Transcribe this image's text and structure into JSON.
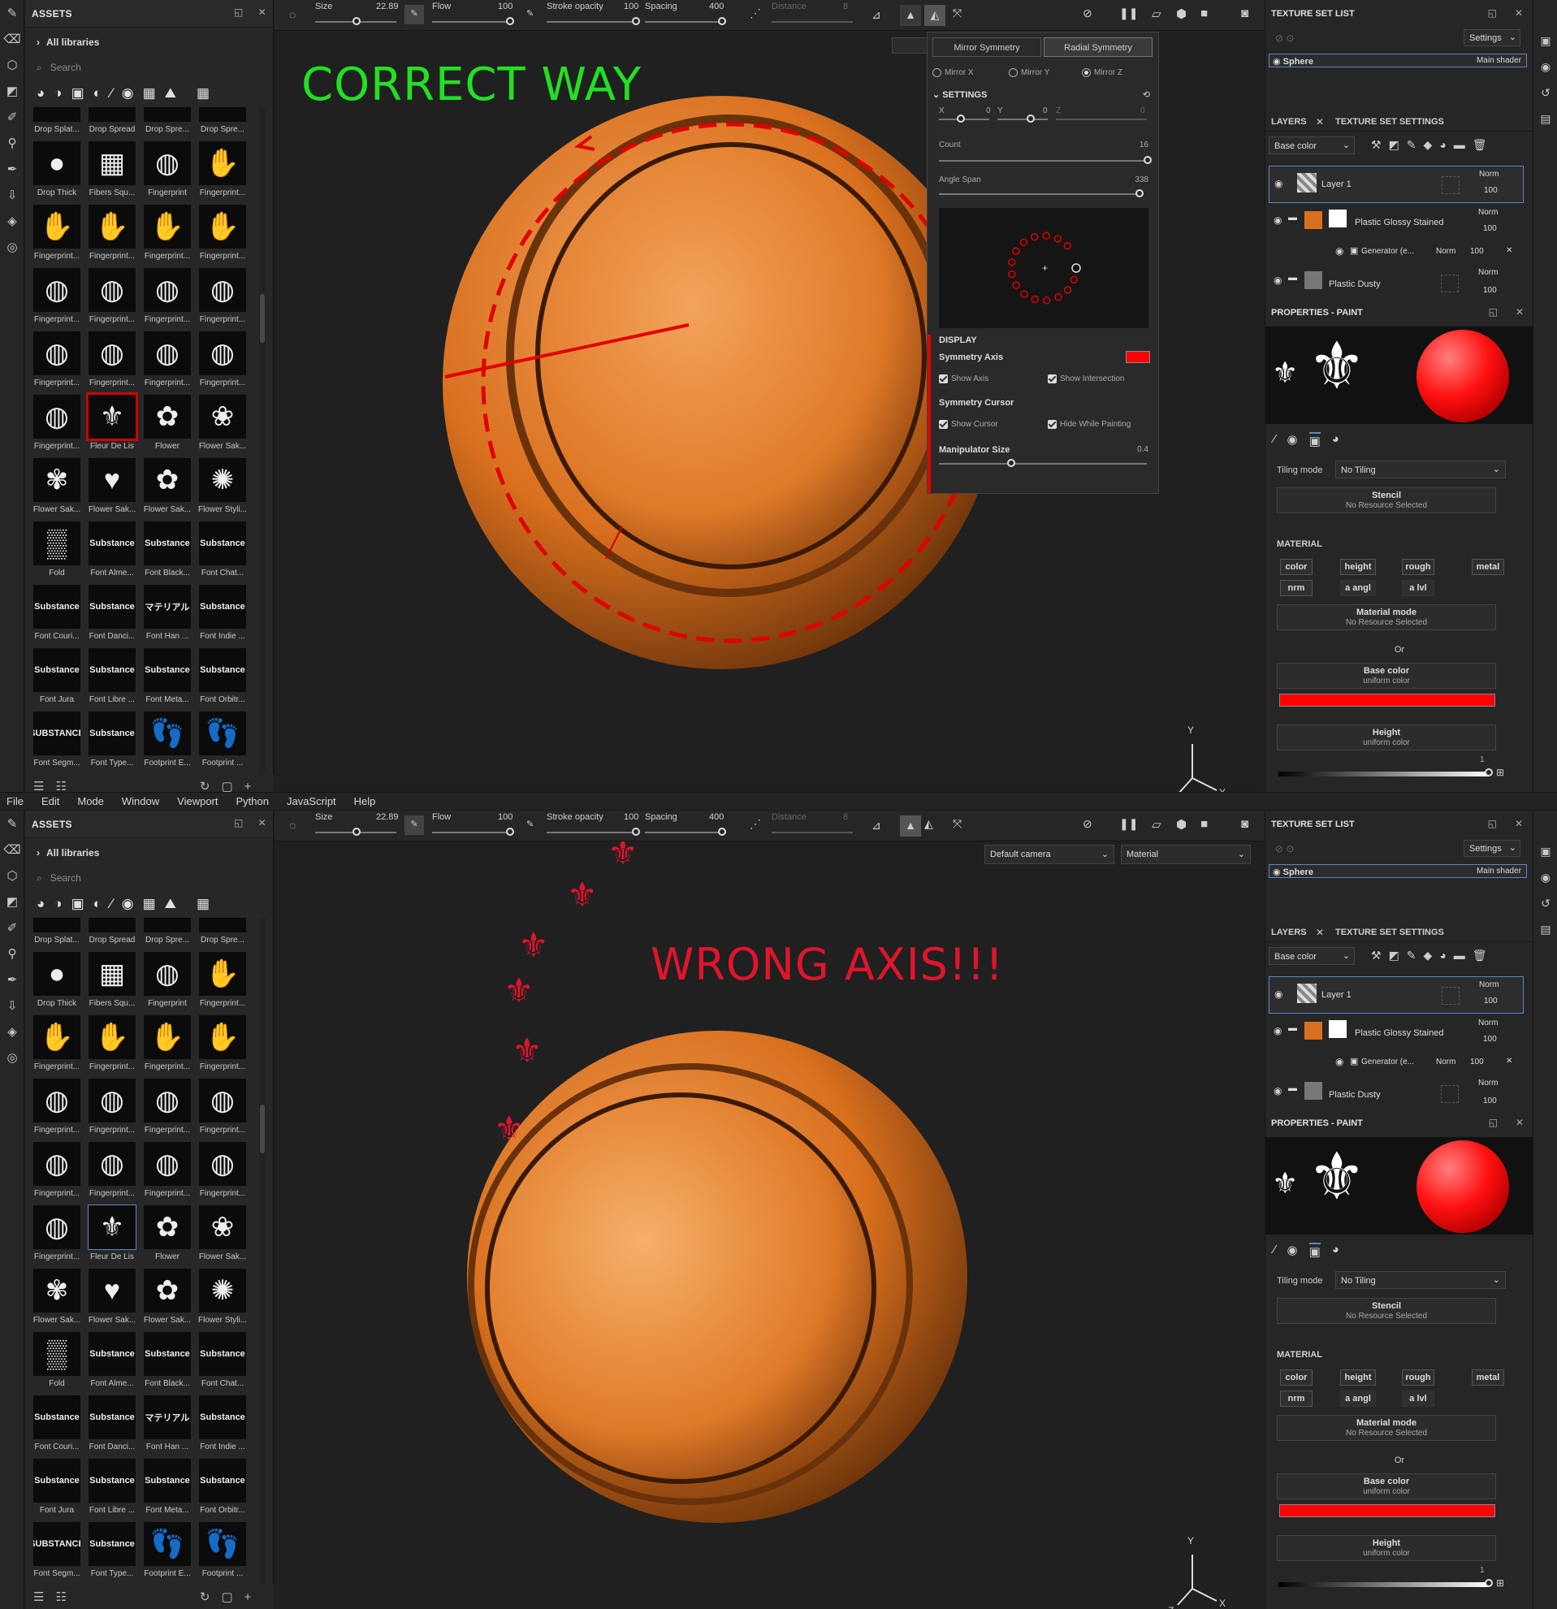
{
  "menu": [
    "File",
    "Edit",
    "Mode",
    "Window",
    "Viewport",
    "Python",
    "JavaScript",
    "Help"
  ],
  "assets": {
    "title": "ASSETS",
    "library": "All libraries",
    "search_placeholder": "Search",
    "items": [
      {
        "label": "Drop Splat...",
        "glyph": "·"
      },
      {
        "label": "Drop Spread",
        "glyph": "·"
      },
      {
        "label": "Drop Spre...",
        "glyph": "·"
      },
      {
        "label": "Drop Spre...",
        "glyph": "·"
      },
      {
        "label": "Drop Thick",
        "glyph": "●"
      },
      {
        "label": "Fibers Squ...",
        "glyph": "▦"
      },
      {
        "label": "Fingerprint",
        "glyph": "◍"
      },
      {
        "label": "Fingerprint...",
        "glyph": "✋"
      },
      {
        "label": "Fingerprint...",
        "glyph": "✋"
      },
      {
        "label": "Fingerprint...",
        "glyph": "✋"
      },
      {
        "label": "Fingerprint...",
        "glyph": "✋"
      },
      {
        "label": "Fingerprint...",
        "glyph": "✋"
      },
      {
        "label": "Fingerprint...",
        "glyph": "◍"
      },
      {
        "label": "Fingerprint...",
        "glyph": "◍"
      },
      {
        "label": "Fingerprint...",
        "glyph": "◍"
      },
      {
        "label": "Fingerprint...",
        "glyph": "◍"
      },
      {
        "label": "Fingerprint...",
        "glyph": "◍"
      },
      {
        "label": "Fingerprint...",
        "glyph": "◍"
      },
      {
        "label": "Fingerprint...",
        "glyph": "◍"
      },
      {
        "label": "Fingerprint...",
        "glyph": "◍"
      },
      {
        "label": "Fingerprint...",
        "glyph": "◍"
      },
      {
        "label": "Fleur De Lis",
        "glyph": "⚜"
      },
      {
        "label": "Flower",
        "glyph": "✿"
      },
      {
        "label": "Flower Sak...",
        "glyph": "❀"
      },
      {
        "label": "Flower Sak...",
        "glyph": "✾"
      },
      {
        "label": "Flower Sak...",
        "glyph": "♥"
      },
      {
        "label": "Flower Sak...",
        "glyph": "✿"
      },
      {
        "label": "Flower Styli...",
        "glyph": "✺"
      },
      {
        "label": "Fold",
        "glyph": "▒"
      },
      {
        "label": "Font Alme...",
        "glyph": "Substance"
      },
      {
        "label": "Font Black...",
        "glyph": "Substance"
      },
      {
        "label": "Font Chat...",
        "glyph": "Substance"
      },
      {
        "label": "Font Couri...",
        "glyph": "Substance"
      },
      {
        "label": "Font Danci...",
        "glyph": "Substance"
      },
      {
        "label": "Font Han ...",
        "glyph": "マテリアル"
      },
      {
        "label": "Font Indie ...",
        "glyph": "Substance"
      },
      {
        "label": "Font Jura",
        "glyph": "Substance"
      },
      {
        "label": "Font Libre ...",
        "glyph": "Substance"
      },
      {
        "label": "Font Meta...",
        "glyph": "Substance"
      },
      {
        "label": "Font Orbitr...",
        "glyph": "Substance"
      },
      {
        "label": "Font Segm...",
        "glyph": "SUBSTANCE"
      },
      {
        "label": "Font Type...",
        "glyph": "Substance"
      },
      {
        "label": "Footprint E...",
        "glyph": "👣"
      },
      {
        "label": "Footprint ...",
        "glyph": "👣"
      }
    ]
  },
  "toolbar": {
    "size_label": "Size",
    "size_value": "22.89",
    "flow_label": "Flow",
    "flow_value": "100",
    "opacity_label": "Stroke opacity",
    "opacity_value": "100",
    "spacing_label": "Spacing",
    "spacing_value": "400",
    "distance_label": "Distance",
    "distance_value": "8"
  },
  "camera": {
    "value": "Default camera",
    "mode": "Material"
  },
  "symmetry": {
    "tab_mirror": "Mirror Symmetry",
    "tab_radial": "Radial Symmetry",
    "mirror_x": "Mirror X",
    "mirror_y": "Mirror Y",
    "mirror_z": "Mirror Z",
    "settings": "SETTINGS",
    "x_label": "X",
    "x_val": "0",
    "y_label": "Y",
    "y_val": "0",
    "z_label": "Z",
    "z_val": "0",
    "count_label": "Count",
    "count_val": "16",
    "angle_label": "Angle Span",
    "angle_val": "338",
    "display": "DISPLAY",
    "sym_axis": "Symmetry Axis",
    "show_axis": "Show Axis",
    "show_intersection": "Show Intersection",
    "sym_cursor": "Symmetry Cursor",
    "show_cursor": "Show Cursor",
    "hide_painting": "Hide While Painting",
    "manip": "Manipulator Size",
    "manip_val": "0.4",
    "axis_color": "#ff0000"
  },
  "annotations": {
    "correct": "CORRECT WAY",
    "wrong": "WRONG AXIS!!!",
    "correct_color": "#22e022",
    "wrong_color": "#e0142c"
  },
  "texture_set": {
    "title": "TEXTURE SET LIST",
    "settings": "Settings",
    "name": "Sphere",
    "shader": "Main shader"
  },
  "layers": {
    "tab_layers": "LAYERS",
    "tab_tss": "TEXTURE SET SETTINGS",
    "channel": "Base color",
    "rows": [
      {
        "name": "Layer 1",
        "blend": "Norm",
        "opacity": "100"
      },
      {
        "name": "Plastic Glossy Stained",
        "blend": "Norm",
        "opacity": "100"
      },
      {
        "name": "Generator (e...",
        "blend": "Norm",
        "opacity": "100"
      },
      {
        "name": "Plastic Dusty",
        "blend": "Norm",
        "opacity": "100"
      }
    ]
  },
  "properties": {
    "title": "PROPERTIES - PAINT",
    "tiling_label": "Tiling mode",
    "tiling_value": "No Tiling",
    "stencil": "Stencil",
    "stencil_sub": "No Resource Selected",
    "material": "MATERIAL",
    "chips": [
      "color",
      "height",
      "rough",
      "metal",
      "nrm",
      "a angl",
      "a lvl"
    ],
    "mat_mode": "Material mode",
    "mat_mode_sub": "No Resource Selected",
    "or": "Or",
    "base_color": "Base color",
    "base_sub": "uniform color",
    "base_swatch": "#ff0000",
    "height": "Height",
    "height_sub": "uniform color",
    "height_val": "1"
  },
  "axis": {
    "x": "X",
    "y": "Y",
    "z": "Z"
  }
}
